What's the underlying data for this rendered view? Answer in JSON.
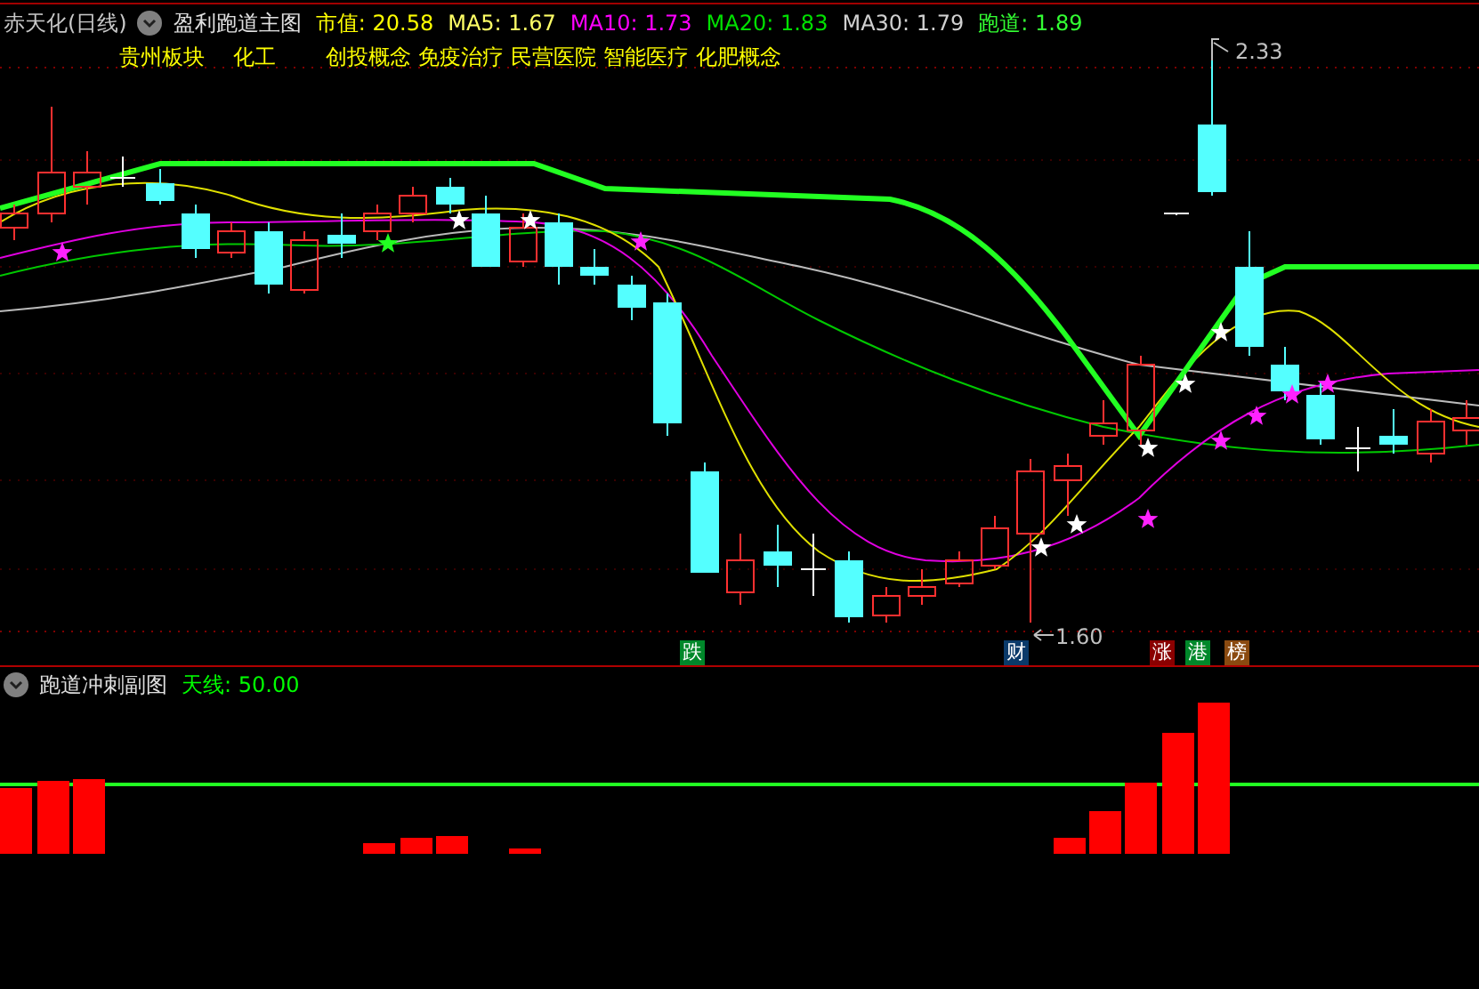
{
  "main_panel": {
    "stock_title": "赤天化(日线)",
    "indicator_name": "盈利跑道主图",
    "values": [
      {
        "label": "市值: 20.58",
        "color": "#ffff00"
      },
      {
        "label": "MA5: 1.67",
        "color": "#ffff66"
      },
      {
        "label": "MA10: 1.73",
        "color": "#ff00ff"
      },
      {
        "label": "MA20: 1.83",
        "color": "#00e000"
      },
      {
        "label": "MA30: 1.79",
        "color": "#d0d0d0"
      },
      {
        "label": "跑道: 1.89",
        "color": "#33ff33"
      }
    ],
    "sectors": [
      "贵州板块",
      "化工",
      "创投概念",
      "免疫治疗",
      "民营医院",
      "智能医疗",
      "化肥概念"
    ],
    "high_label": "2.33",
    "low_label": "1.60",
    "markers": [
      {
        "text": "跌",
        "color": "#00882a"
      },
      {
        "text": "财",
        "color": "#0a3a6a"
      },
      {
        "text": "涨",
        "color": "#8a0000"
      },
      {
        "text": "港",
        "color": "#00882a"
      },
      {
        "text": "榜",
        "color": "#8a4a10"
      }
    ]
  },
  "sub_panel": {
    "indicator_name": "跑道冲刺副图",
    "values": [
      {
        "label": "天线: 50.00",
        "color": "#00ff00"
      }
    ]
  }
}
